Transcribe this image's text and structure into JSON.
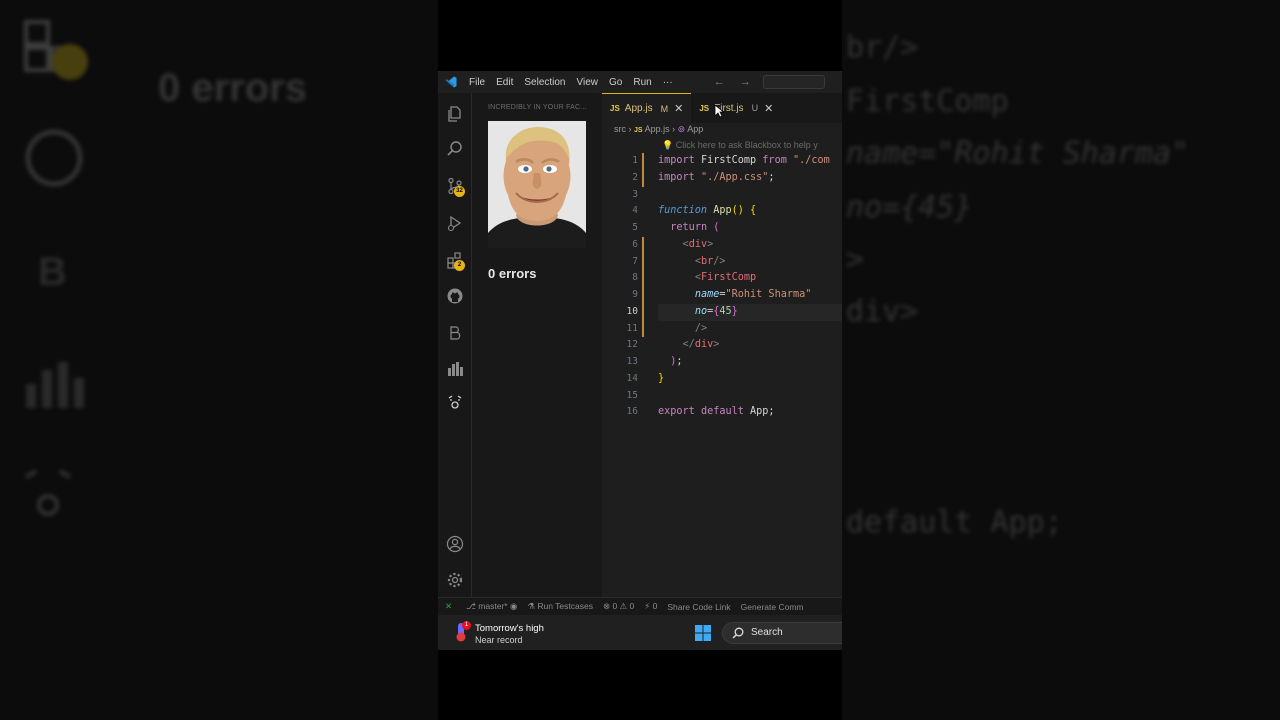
{
  "background": {
    "errors_text": "0 errors",
    "right_code_lines": [
      "br/>",
      "FirstComp",
      "name=\"Rohit Sharma\"",
      "no={45}",
      ">",
      "div>",
      "default App;"
    ]
  },
  "titlebar": {
    "menus": [
      "File",
      "Edit",
      "Selection",
      "View",
      "Go",
      "Run",
      "···"
    ],
    "nav": "← →"
  },
  "activity_badges": {
    "source_control": "32",
    "extensions": "2"
  },
  "sidebar": {
    "title": "INCREDIBLY IN YOUR FAC...",
    "errors_text": "0 errors"
  },
  "editor": {
    "tabs": [
      {
        "label": "App.js",
        "flag": "M",
        "close": "✕"
      },
      {
        "label": "First.js",
        "flag": "U",
        "close": "✕"
      }
    ],
    "tab_icon": "JS",
    "breadcrumb": {
      "folder": "src",
      "sep": "›",
      "file": "App.js",
      "symbol": "App"
    },
    "hint": "Click here to ask Blackbox to help y",
    "line_numbers": [
      "1",
      "2",
      "3",
      "4",
      "5",
      "6",
      "7",
      "8",
      "9",
      "10",
      "11",
      "12",
      "13",
      "14",
      "15",
      "16"
    ],
    "current_line": "10"
  },
  "statusbar": {
    "remote": "✕",
    "branch": "master*",
    "run_testcases": "Run Testcases",
    "problems": "⊗ 0 ⚠ 0",
    "ports": "⚡ 0",
    "share": "Share Code Link",
    "generate": "Generate Comm"
  },
  "taskbar": {
    "weather_title": "Tomorrow's high",
    "weather_sub": "Near record",
    "weather_badge": "1",
    "search_label": "Search"
  },
  "colors": {
    "accent_tab": "#e7b416",
    "keyword": "#c586c0",
    "string": "#ce9178",
    "tag": "#e06c75"
  }
}
